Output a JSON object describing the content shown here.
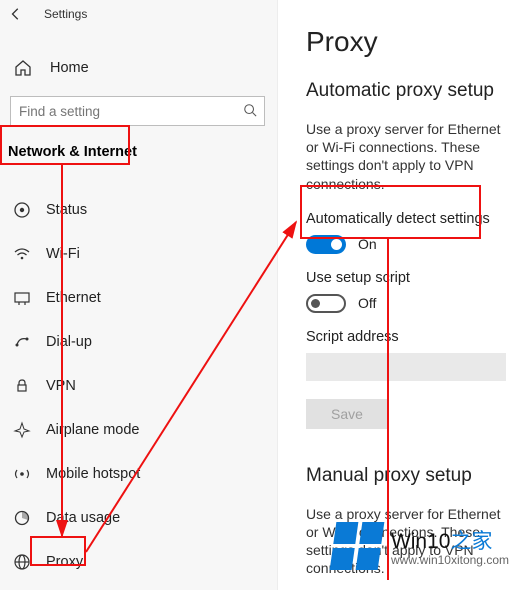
{
  "header": {
    "app_title": "Settings"
  },
  "home_label": "Home",
  "search": {
    "placeholder": "Find a setting"
  },
  "category_heading": "Network & Internet",
  "nav_items": [
    {
      "id": "status",
      "label": "Status"
    },
    {
      "id": "wifi",
      "label": "Wi-Fi"
    },
    {
      "id": "ethernet",
      "label": "Ethernet"
    },
    {
      "id": "dialup",
      "label": "Dial-up"
    },
    {
      "id": "vpn",
      "label": "VPN"
    },
    {
      "id": "airplane",
      "label": "Airplane mode"
    },
    {
      "id": "hotspot",
      "label": "Mobile hotspot"
    },
    {
      "id": "datausage",
      "label": "Data usage"
    },
    {
      "id": "proxy",
      "label": "Proxy"
    }
  ],
  "main": {
    "page_title": "Proxy",
    "section_auto_title": "Automatic proxy setup",
    "auto_desc": "Use a proxy server for Ethernet or Wi-Fi connections. These settings don't apply to VPN connections.",
    "auto_detect_label": "Automatically detect settings",
    "auto_detect_state": "On",
    "setup_script_label": "Use setup script",
    "setup_script_state": "Off",
    "script_address_label": "Script address",
    "save_label": "Save",
    "section_manual_title": "Manual proxy setup",
    "manual_desc": "Use a proxy server for Ethernet or Wi-Fi connections. These settings don't apply to VPN connections."
  },
  "watermark": {
    "main_a": "Win10",
    "main_b": "之家",
    "url": "www.win10xitong.com"
  },
  "colors": {
    "accent": "#0078d7",
    "annotation": "#e11"
  }
}
